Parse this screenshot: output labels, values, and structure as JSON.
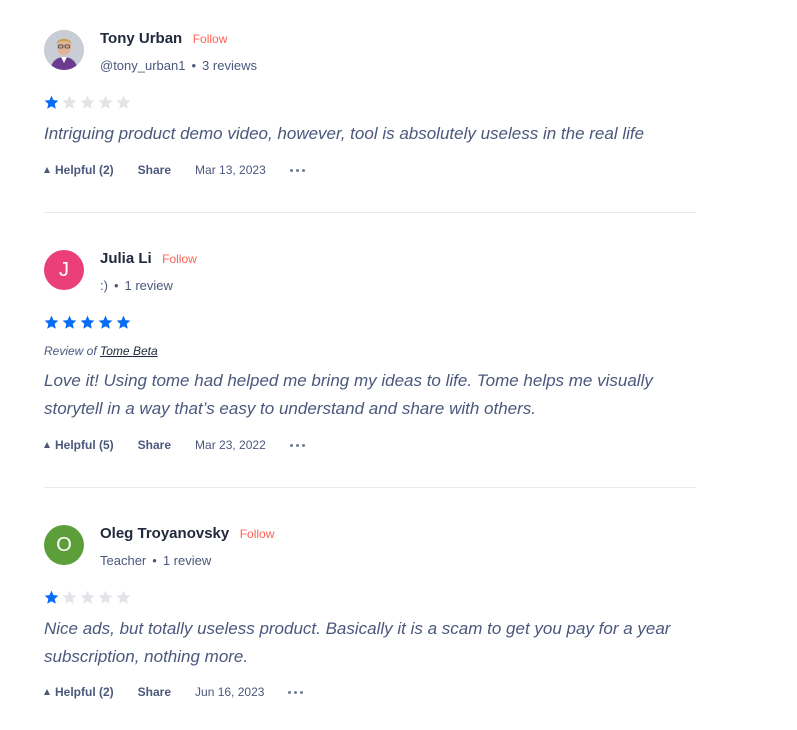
{
  "colors": {
    "star_filled": "#0a6cf5",
    "star_empty": "#e3e3e8",
    "follow": "#ff6154",
    "avatar_julia": "#ea3f78",
    "avatar_oleg": "#5c9f3a"
  },
  "reviews": [
    {
      "name": "Tony Urban",
      "follow_label": "Follow",
      "handle": "@tony_urban1",
      "count_label": "3 reviews",
      "avatar_type": "photo",
      "rating": 1,
      "max_rating": 5,
      "text": "Intriguing product demo video, however, tool is absolutely useless in the real life",
      "helpful_label": "Helpful (2)",
      "share_label": "Share",
      "date": "Mar 13, 2023"
    },
    {
      "name": "Julia Li",
      "follow_label": "Follow",
      "handle": ":)",
      "count_label": "1 review",
      "avatar_type": "initial",
      "avatar_letter": "J",
      "rating": 5,
      "max_rating": 5,
      "review_of_prefix": "Review of",
      "review_of_product": "Tome Beta",
      "text": "Love it! Using tome had helped me bring my ideas to life. Tome helps me visually storytell in a way that’s easy to understand and share with others.",
      "helpful_label": "Helpful (5)",
      "share_label": "Share",
      "date": "Mar 23, 2022"
    },
    {
      "name": "Oleg Troyanovsky",
      "follow_label": "Follow",
      "handle": "Teacher",
      "count_label": "1 review",
      "avatar_type": "initial",
      "avatar_letter": "O",
      "rating": 1,
      "max_rating": 5,
      "text": "Nice ads, but totally useless product. Basically it is a scam to get you pay for a year subscription, nothing more.",
      "helpful_label": "Helpful (2)",
      "share_label": "Share",
      "date": "Jun 16, 2023"
    }
  ],
  "icons": {
    "star": "star-icon",
    "upvote": "upvote-triangle-icon",
    "more": "more-dots-icon"
  }
}
